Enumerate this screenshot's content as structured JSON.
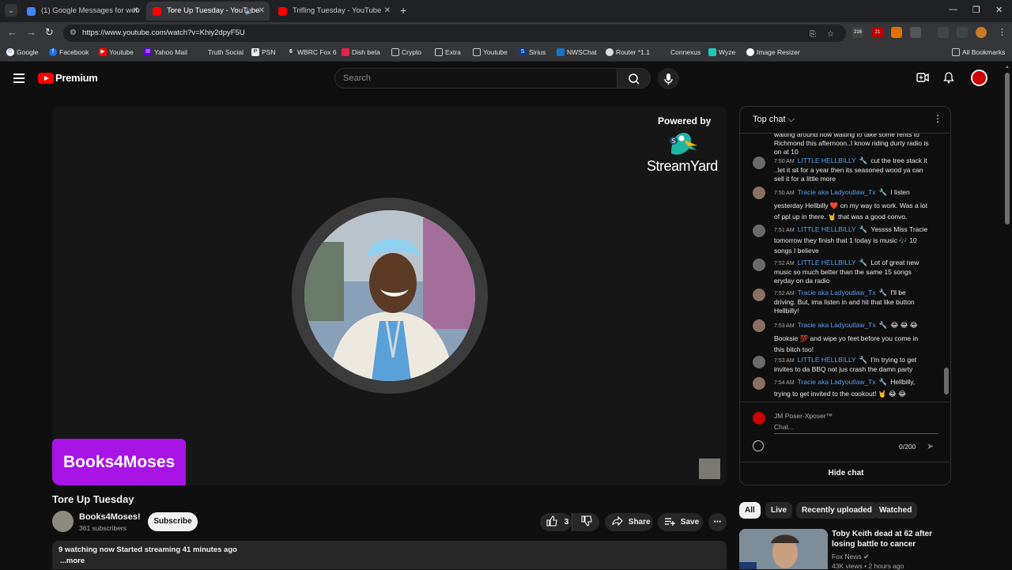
{
  "browser": {
    "tabs": [
      {
        "title": "(1) Google Messages for web",
        "active": false
      },
      {
        "title": "Tore Up Tuesday - YouTube",
        "active": true
      },
      {
        "title": "Trifling Tuesday - YouTube",
        "active": false
      }
    ],
    "url": "https://www.youtube.com/watch?v=Khiy2dpyF5U",
    "extension_badges": [
      "216",
      "21"
    ],
    "bookmarks": [
      "Google",
      "Facebook",
      "Youtube",
      "Yahoo Mail",
      "Truth Social",
      "PSN",
      "WBRC Fox 6",
      "Dish beta",
      "Crypto",
      "Extra",
      "Youtube",
      "Sirius",
      "NWSChat",
      "Router *1.1",
      "Connexus",
      "Wyze",
      "Image Resizer"
    ],
    "all_bookmarks": "All Bookmarks"
  },
  "masthead": {
    "brand": "Premium",
    "search_placeholder": "Search"
  },
  "player": {
    "powered_by": "Powered by",
    "streamyard": "StreamYard",
    "nameplate": "Books4Moses"
  },
  "video": {
    "title": "Tore Up Tuesday",
    "channel": "Books4Moses!",
    "subscribers": "361 subscribers",
    "subscribe_label": "Subscribe",
    "likes": "3",
    "share_label": "Share",
    "save_label": "Save",
    "description_line1": "9 watching now  Started streaming 41 minutes ago",
    "description_more": "...more"
  },
  "chat": {
    "header": "Top chat",
    "messages": [
      {
        "time": "",
        "author": "",
        "text": "waiting around now waiting to take some rents to Richmond this afternoon..I know riding durty radio is on at 10"
      },
      {
        "time": "7:50 AM",
        "author": "LITTLE HELLBILLY",
        "text": "cut the tree stack it ..let it sit for a year then its seasoned wood ya can sell it for a little more"
      },
      {
        "time": "7:50 AM",
        "author": "Tracie aka Ladyoutlaw_Tx",
        "text": "I listen yesterday Hellbilly ❤️ on my way to work. Was a lot of ppl up in there. 🤘 that was a good convo."
      },
      {
        "time": "7:51 AM",
        "author": "LITTLE HELLBILLY",
        "text": "Yessss Miss Tracie tomorrow they finish that 1 today is music 🎶 10 songs I believe"
      },
      {
        "time": "7:52 AM",
        "author": "LITTLE HELLBILLY",
        "text": "Lot of great new music so much better than the same 15 songs eryday on da radio"
      },
      {
        "time": "7:52 AM",
        "author": "Tracie aka Ladyoutlaw_Tx",
        "text": "I'll be driving. But, ima listen in and hit that like button Hellbilly!"
      },
      {
        "time": "7:53 AM",
        "author": "Tracie aka Ladyoutlaw_Tx",
        "text": "😂 😂 😂 Booksie 💯 and wipe yo feet before you come in this bitch too!"
      },
      {
        "time": "7:53 AM",
        "author": "LITTLE HELLBILLY",
        "text": "I'm trying to get invites to da BBQ not jus crash the damn party"
      },
      {
        "time": "7:54 AM",
        "author": "Tracie aka Ladyoutlaw_Tx",
        "text": "Hellbilly, trying to get invited to the cookout! 🤘 😂 😂"
      }
    ],
    "composer_name": "JM Poser-Xposer™",
    "composer_placeholder": "Chat...",
    "char_count": "0/200",
    "hide_chat": "Hide chat"
  },
  "chips": [
    "All",
    "Live",
    "Recently uploaded",
    "Watched"
  ],
  "recommendation": {
    "title": "Toby Keith dead at 62 after losing battle to cancer",
    "channel": "Fox News",
    "meta": "43K views • 2 hours ago"
  }
}
